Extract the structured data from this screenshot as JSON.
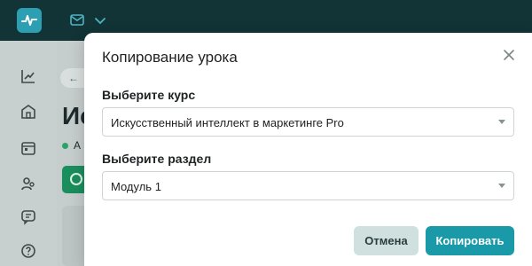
{
  "colors": {
    "topbar": "#123436",
    "accent": "#1a9aa8",
    "cancel_bg": "#cfe0de",
    "status_green": "#2aa36b"
  },
  "background": {
    "back_label": "←",
    "title_fragment": "Ис",
    "status_fragment": "А"
  },
  "modal": {
    "title": "Копирование урока",
    "course": {
      "label": "Выберите курс",
      "value": "Искусственный интеллект в маркетинге Pro"
    },
    "section": {
      "label": "Выберите раздел",
      "value": "Модуль 1"
    },
    "buttons": {
      "cancel": "Отмена",
      "copy": "Копировать"
    }
  },
  "icons": {
    "logo": "pulse-icon",
    "top": [
      "mail-icon",
      "chevron-down-icon"
    ],
    "sidebar": [
      "chart-icon",
      "building-icon",
      "calendar-icon",
      "users-icon",
      "chat-icon",
      "help-icon"
    ],
    "close": "close-icon"
  }
}
